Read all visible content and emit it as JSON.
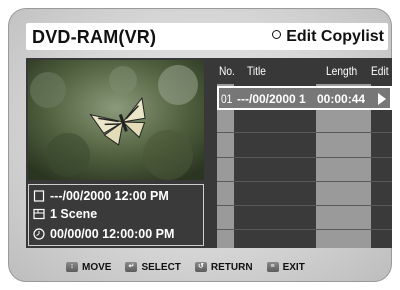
{
  "header": {
    "title": "DVD-RAM(VR)",
    "mode_label": "Edit Copylist"
  },
  "info": {
    "date_line": "---/00/2000 12:00 PM",
    "scene_line": "1 Scene",
    "time_line": "00/00/00 12:00:00 PM"
  },
  "list": {
    "columns": {
      "no": "No.",
      "title": "Title",
      "length": "Length",
      "edit": "Edit"
    },
    "rows": [
      {
        "no": "01",
        "title": "---/00/2000 1",
        "length": "00:00:44",
        "edit_icon": "play-arrow-icon"
      }
    ]
  },
  "footer": {
    "move": "MOVE",
    "select": "SELECT",
    "return": "RETURN",
    "exit": "EXIT"
  }
}
